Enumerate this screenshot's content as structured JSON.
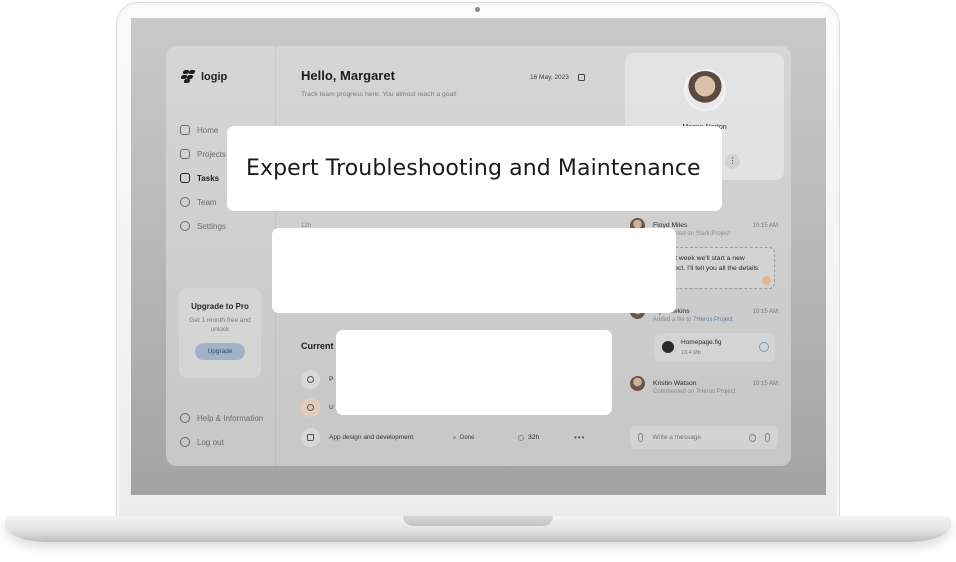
{
  "app": {
    "brand": "logip",
    "nav": [
      {
        "label": "Home",
        "icon": "home-icon"
      },
      {
        "label": "Projects",
        "icon": "grid-icon"
      },
      {
        "label": "Tasks",
        "icon": "tasks-icon",
        "active": true
      },
      {
        "label": "Team",
        "icon": "team-icon"
      },
      {
        "label": "Settings",
        "icon": "gear-icon"
      }
    ],
    "upgrade": {
      "title": "Upgrade to Pro",
      "subtitle": "Get 1 month free and unlock",
      "button": "Upgrade"
    },
    "bottom_nav": [
      {
        "label": "Help & Information",
        "icon": "info-icon"
      },
      {
        "label": "Log out",
        "icon": "logout-icon"
      }
    ]
  },
  "main": {
    "greeting": "Hello, Margaret",
    "subtitle": "Track team progress here. You almost reach a goal!",
    "date": "16 May, 2023",
    "axis_tick": "12h",
    "current_title": "Current",
    "tasks": [
      {
        "name": "P",
        "status": "",
        "time": ""
      },
      {
        "name": "U",
        "status": "",
        "time": ""
      },
      {
        "name": "App design and development",
        "status": "Done",
        "time": "32h"
      }
    ]
  },
  "profile": {
    "name": "Megan Norton",
    "more": "⋮"
  },
  "activity": [
    {
      "name": "Floyd Miles",
      "time": "10:15 AM",
      "sub": "Commented on Stark Project"
    },
    {
      "name": "...y Hawkins",
      "time": "10:15 AM",
      "sub_prefix": "Added a file to ",
      "sub_link": "7Heros Project"
    },
    {
      "name": "Kristin Watson",
      "time": "10:15 AM",
      "sub": "Commented on 7Heros Project"
    }
  ],
  "bubble": "Next week we'll start a new project. I'll tell you all the details later",
  "file": {
    "name": "Homepage.fig",
    "size": "13.4 Mb"
  },
  "composer": {
    "placeholder": "Write a message"
  },
  "overlays": {
    "headline": "Expert Troubleshooting and Maintenance"
  },
  "colors": {
    "screen_bg": "#b9b9b9",
    "upgrade_button": "#9fb3c8",
    "link": "#5d7fa3",
    "card_bg": "#ffffff"
  }
}
